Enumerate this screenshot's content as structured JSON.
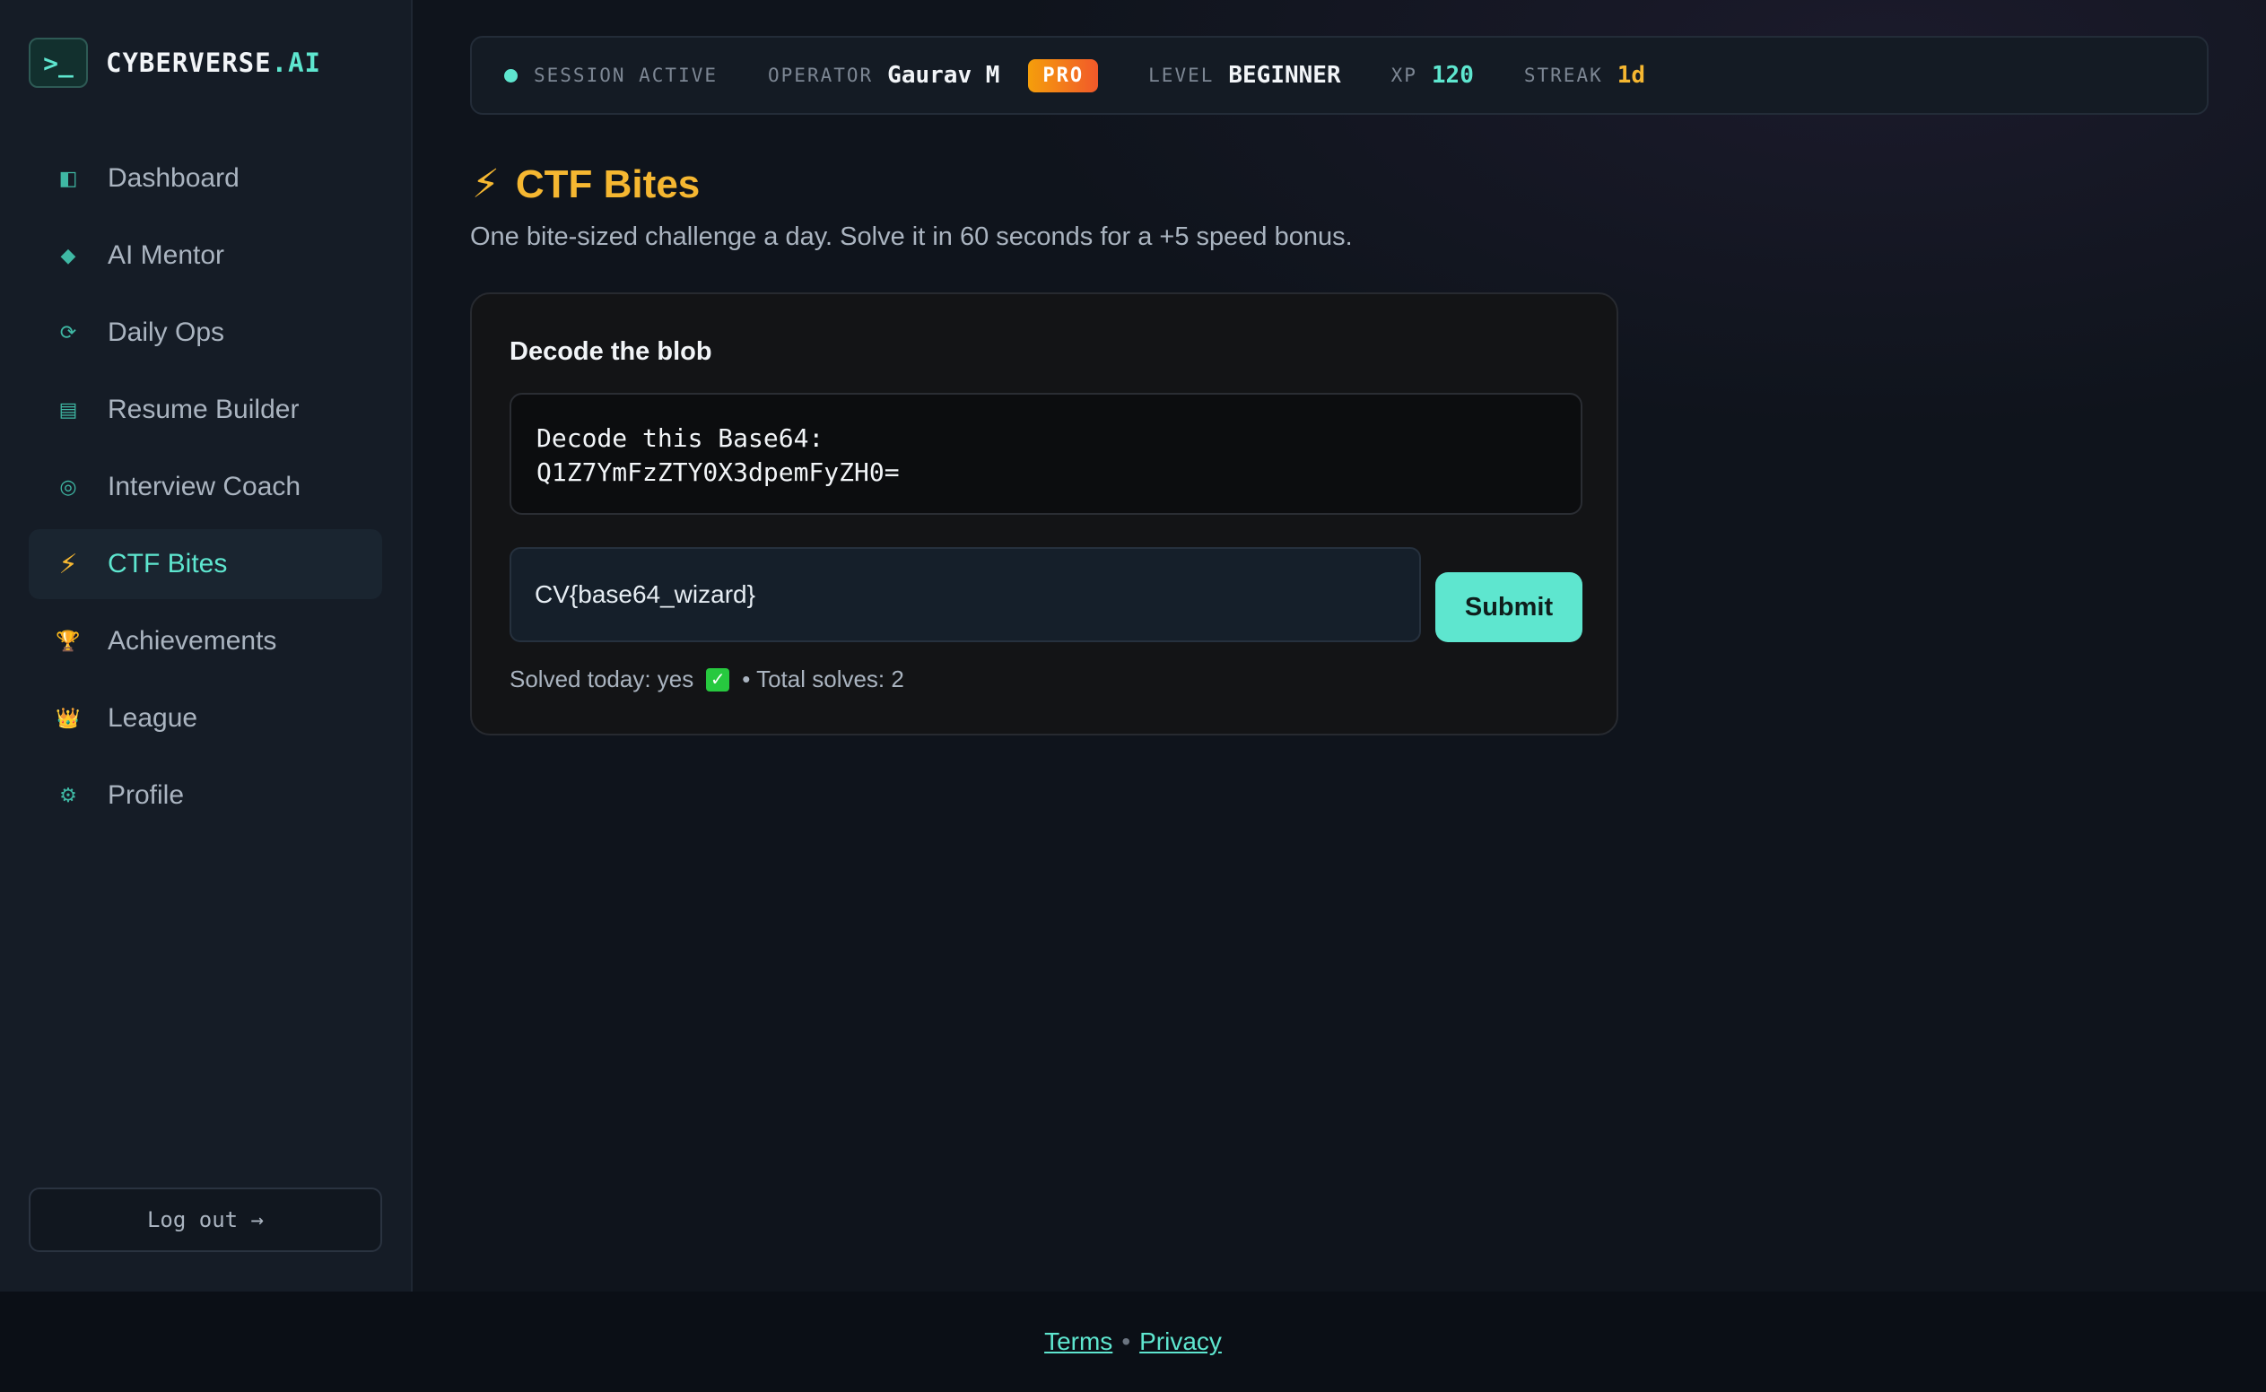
{
  "brand": {
    "badge": ">_",
    "name": "CYBERVERSE",
    "name_accent": ".AI"
  },
  "sidebar": {
    "items": [
      {
        "label": "Dashboard",
        "icon": "dashboard-icon",
        "glyph": "◧",
        "active": false
      },
      {
        "label": "AI Mentor",
        "icon": "diamond-icon",
        "glyph": "◆",
        "active": false
      },
      {
        "label": "Daily Ops",
        "icon": "refresh-icon",
        "glyph": "⟳",
        "active": false
      },
      {
        "label": "Resume Builder",
        "icon": "document-icon",
        "glyph": "▤",
        "active": false
      },
      {
        "label": "Interview Coach",
        "icon": "target-icon",
        "glyph": "◎",
        "active": false
      },
      {
        "label": "CTF Bites",
        "icon": "bolt-icon",
        "glyph": "⚡",
        "active": true
      },
      {
        "label": "Achievements",
        "icon": "trophy-icon",
        "glyph": "🏆",
        "active": false
      },
      {
        "label": "League",
        "icon": "crown-icon",
        "glyph": "👑",
        "active": false
      },
      {
        "label": "Profile",
        "icon": "gear-icon",
        "glyph": "⚙",
        "active": false
      }
    ],
    "logout_label": "Log out →"
  },
  "topbar": {
    "session_label": "SESSION ACTIVE",
    "operator_label": "OPERATOR",
    "operator_name": "Gaurav M",
    "plan_badge": "PRO",
    "level_label": "LEVEL",
    "level_value": "BEGINNER",
    "xp_label": "XP",
    "xp_value": "120",
    "streak_label": "STREAK",
    "streak_value": "1d"
  },
  "page": {
    "title": "CTF Bites",
    "subtitle": "One bite-sized challenge a day. Solve it in 60 seconds for a +5 speed bonus."
  },
  "challenge": {
    "title": "Decode the blob",
    "prompt_line1": "Decode this Base64:",
    "prompt_line2": "Q1Z7YmFzZTY0X3dpemFyZH0=",
    "answer_value": "CV{base64_wizard}",
    "submit_label": "Submit",
    "solved_text": "Solved today: yes",
    "total_text": "• Total solves: 2"
  },
  "footer": {
    "terms": "Terms",
    "separator": "•",
    "privacy": "Privacy"
  },
  "colors": {
    "accent": "#5ee6cf",
    "highlight": "#f5b731",
    "background": "#0f141c"
  }
}
